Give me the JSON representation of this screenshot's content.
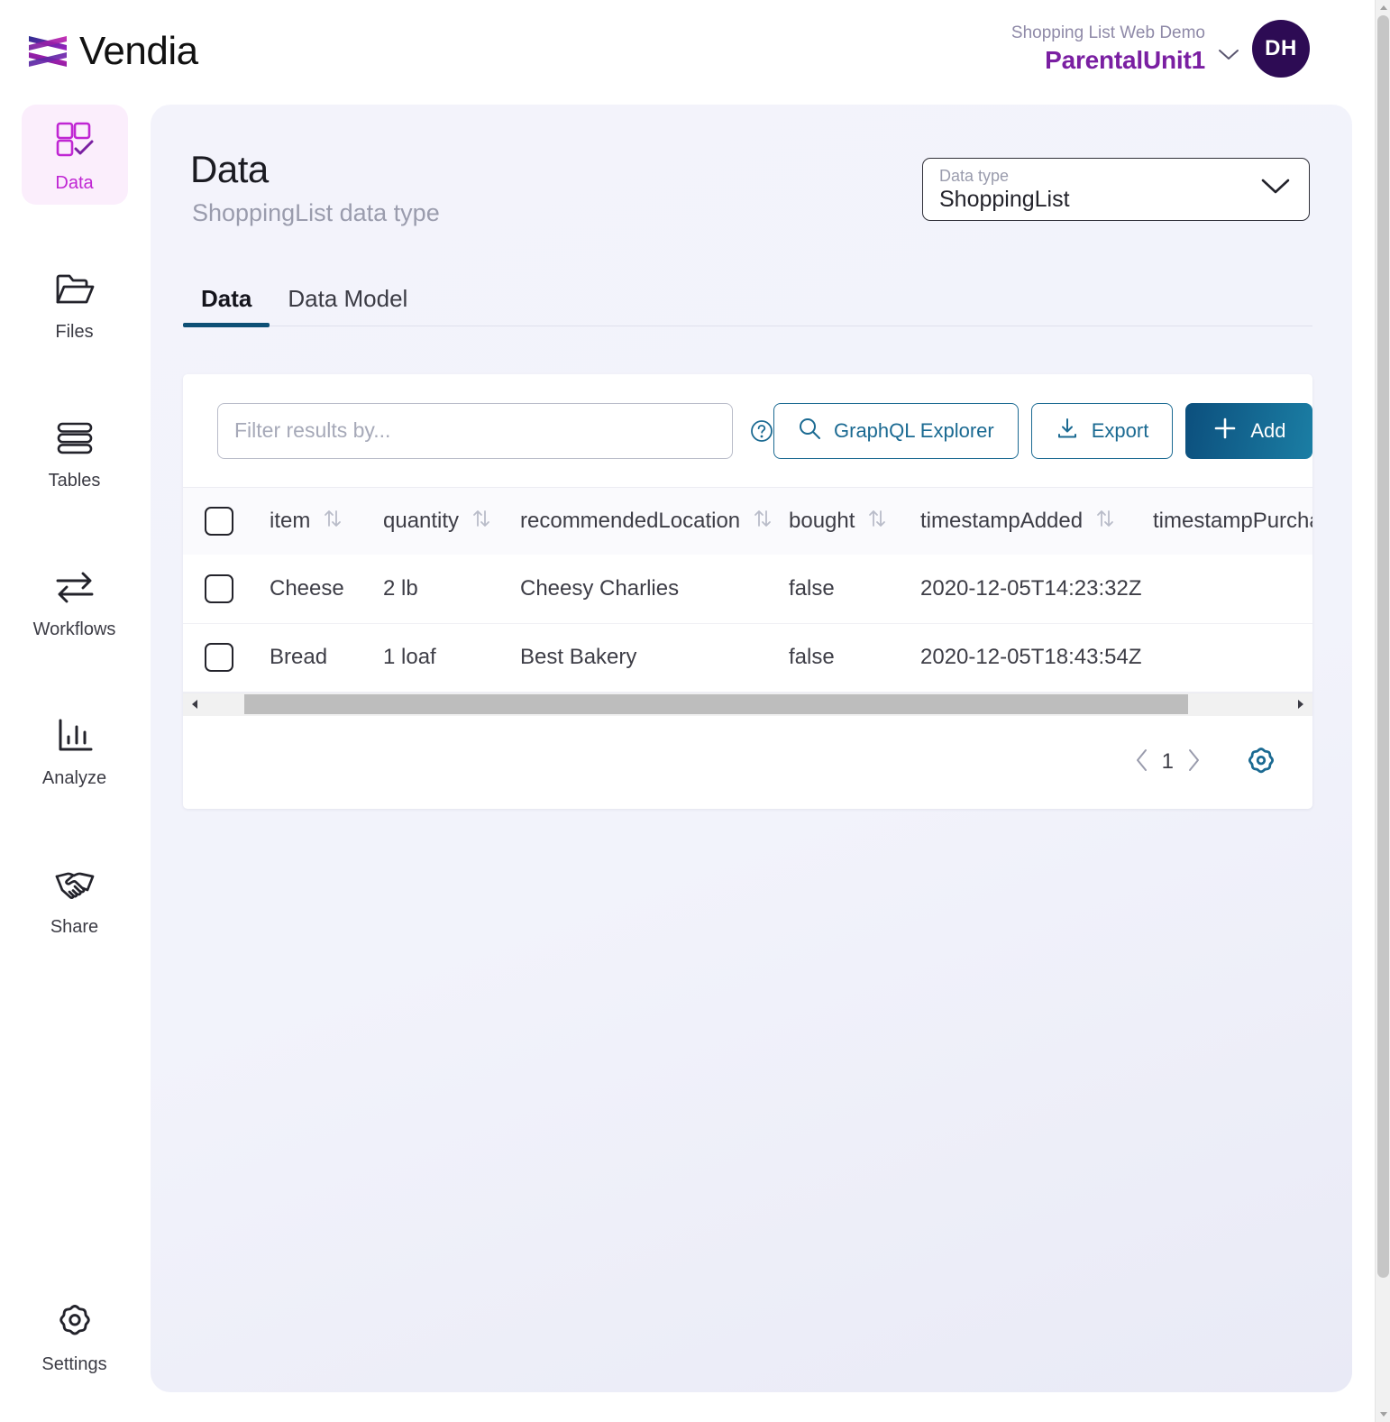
{
  "brand": {
    "name": "Vendia",
    "logo_icon": "vendia-logo-icon"
  },
  "account": {
    "org_label": "Shopping List Web Demo",
    "unit_name": "ParentalUnit1",
    "caret_icon": "chevron-down-icon",
    "avatar_initials": "DH",
    "avatar_color": "#2d0b54",
    "unit_color": "#7a1fa2"
  },
  "sidebar": {
    "items": [
      {
        "label": "Data",
        "icon": "data-grid-check-icon",
        "active": true
      },
      {
        "label": "Files",
        "icon": "folder-open-icon",
        "active": false
      },
      {
        "label": "Tables",
        "icon": "stacked-rows-icon",
        "active": false
      },
      {
        "label": "Workflows",
        "icon": "arrows-exchange-icon",
        "active": false
      },
      {
        "label": "Analyze",
        "icon": "bar-chart-icon",
        "active": false
      },
      {
        "label": "Share",
        "icon": "handshake-icon",
        "active": false
      }
    ],
    "bottom": {
      "label": "Settings",
      "icon": "gear-icon"
    },
    "active_color": "#c026d3",
    "active_bg": "#fbeefc"
  },
  "page": {
    "title": "Data",
    "subtitle": "ShoppingList data type"
  },
  "datatype_select": {
    "label": "Data type",
    "value": "ShoppingList",
    "caret_icon": "chevron-down-icon"
  },
  "tabs": [
    {
      "label": "Data",
      "active": true
    },
    {
      "label": "Data Model",
      "active": false
    }
  ],
  "toolbar": {
    "filter_placeholder": "Filter results by...",
    "filter_value": "",
    "help_icon": "question-circle-icon",
    "graphql_label": "GraphQL Explorer",
    "graphql_icon": "search-icon",
    "export_label": "Export",
    "export_icon": "download-icon",
    "add_label": "Add",
    "add_icon": "plus-icon",
    "primary_color": "#0c4f7d",
    "accent_color": "#1b6a92"
  },
  "table": {
    "select_all_checked": false,
    "sort_icon": "sort-updown-icon",
    "columns": [
      {
        "key": "item",
        "label": "item",
        "sortable": true
      },
      {
        "key": "quantity",
        "label": "quantity",
        "sortable": true
      },
      {
        "key": "recommendedLocation",
        "label": "recommendedLocation",
        "sortable": true
      },
      {
        "key": "bought",
        "label": "bought",
        "sortable": true
      },
      {
        "key": "timestampAdded",
        "label": "timestampAdded",
        "sortable": true
      },
      {
        "key": "timestampPurchased",
        "label": "timestampPurcha",
        "sortable": false
      }
    ],
    "rows": [
      {
        "item": "Cheese",
        "quantity": "2 lb",
        "recommendedLocation": "Cheesy Charlies",
        "bought": "false",
        "timestampAdded": "2020-12-05T14:23:32Z",
        "timestampPurchased": ""
      },
      {
        "item": "Bread",
        "quantity": "1 loaf",
        "recommendedLocation": "Best Bakery",
        "bought": "false",
        "timestampAdded": "2020-12-05T18:43:54Z",
        "timestampPurchased": ""
      }
    ]
  },
  "footer": {
    "prev_icon": "chevron-left-icon",
    "page_number": "1",
    "next_icon": "chevron-right-icon",
    "settings_icon": "gear-icon",
    "settings_color": "#1b6a92"
  }
}
